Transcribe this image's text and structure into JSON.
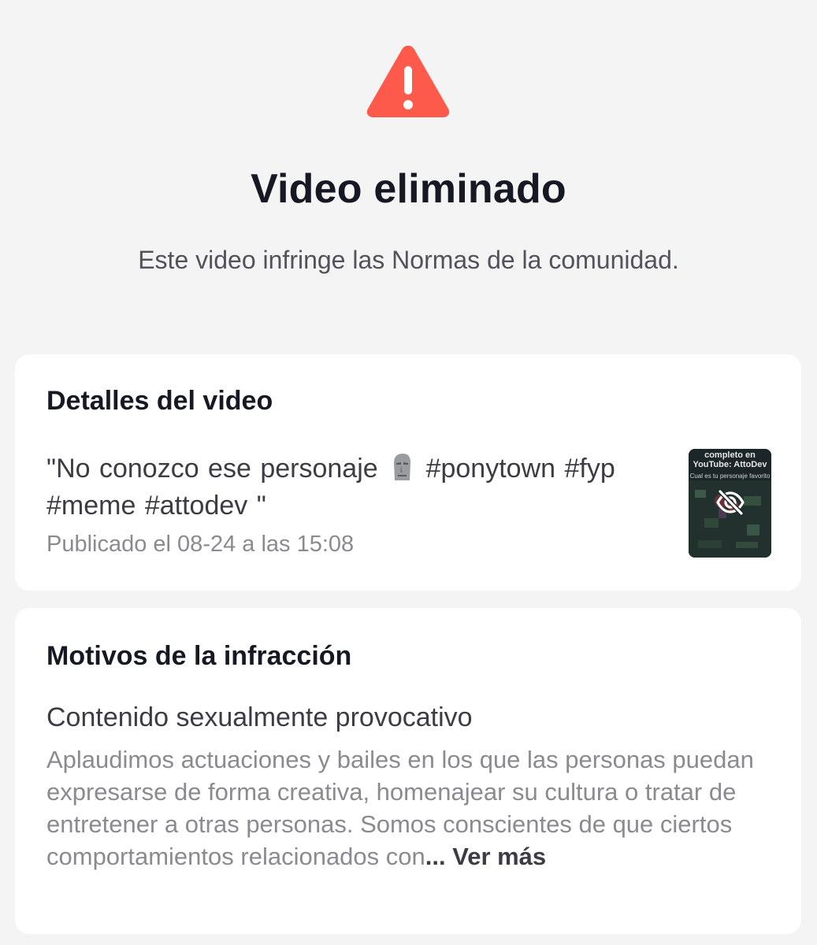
{
  "header": {
    "icon": "warning-triangle-icon",
    "title": "Video eliminado",
    "subtitle": "Este video infringe las Normas de la comunidad."
  },
  "details_card": {
    "heading": "Detalles del video",
    "description_start": "\"No conozco ese personaje",
    "description_emoji": "moai-emoji",
    "description_end": "#ponytown #fyp #meme #attodev \"",
    "published": "Publicado el 08-24 a las 15:08",
    "thumbnail": {
      "caption": "completo en\nYouTube: AttoDev",
      "subcaption": "Cual es tu personaje favorito",
      "overlay_icon": "hidden-eye-icon"
    }
  },
  "reasons_card": {
    "heading": "Motivos de la infracción",
    "reason_title": "Contenido sexualmente provocativo",
    "reason_text": "Aplaudimos actuaciones y bailes en los que las personas puedan expresarse de forma creativa, homenajear su cultura o tratar de entretener a otras personas. Somos conscientes de que ciertos comportamientos relacionados con",
    "ellipsis": "...",
    "see_more": "Ver más"
  },
  "colors": {
    "background": "#f4f4f4",
    "card": "#ffffff",
    "warning": "#fe5a4c",
    "title": "#161823",
    "secondary_text": "#8a8b91"
  }
}
